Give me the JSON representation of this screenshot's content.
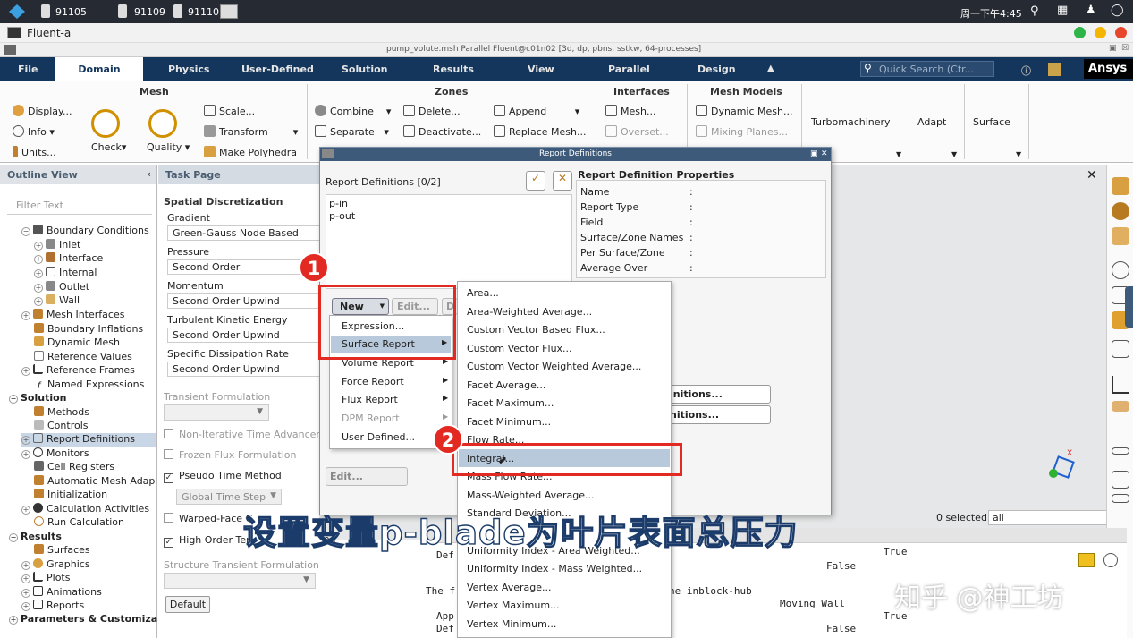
{
  "sysbar": {
    "items": [
      "91105",
      "91109",
      "91110"
    ],
    "clock": "周一下午4:45"
  },
  "window": {
    "title": "Fluent-a",
    "inner_title": "pump_volute.msh Parallel Fluent@c01n02  [3d, dp, pbns, sstkw, 64-processes]"
  },
  "menubar": {
    "tabs": [
      "File",
      "Domain",
      "Physics",
      "User-Defined",
      "Solution",
      "Results",
      "View",
      "Parallel",
      "Design"
    ],
    "search_placeholder": "Quick Search (Ctr...",
    "brand": "Ansys"
  },
  "ribbon": {
    "mesh": {
      "title": "Mesh",
      "display": "Display...",
      "info": "Info",
      "units": "Units...",
      "check": "Check",
      "quality": "Quality",
      "scale": "Scale...",
      "transform": "Transform",
      "make_polyhedra": "Make Polyhedra"
    },
    "zones": {
      "title": "Zones",
      "combine": "Combine",
      "separate": "Separate",
      "delete": "Delete...",
      "deactivate": "Deactivate...",
      "append": "Append",
      "replace_mesh": "Replace Mesh..."
    },
    "interfaces": {
      "title": "Interfaces",
      "mesh": "Mesh...",
      "overset": "Overset..."
    },
    "mesh_models": {
      "title": "Mesh Models",
      "dynamic_mesh": "Dynamic Mesh...",
      "mixing_planes": "Mixing Planes..."
    },
    "turbomachinery": "Turbomachinery",
    "adapt": "Adapt",
    "surface": "Surface"
  },
  "outline": {
    "title": "Outline View",
    "filter_placeholder": "Filter Text",
    "items": [
      "Boundary Conditions",
      "Inlet",
      "Interface",
      "Internal",
      "Outlet",
      "Wall",
      "Mesh Interfaces",
      "Boundary Inflations",
      "Dynamic Mesh",
      "Reference Values",
      "Reference Frames",
      "Named Expressions",
      "Solution",
      "Methods",
      "Controls",
      "Report Definitions",
      "Monitors",
      "Cell Registers",
      "Automatic Mesh Adap",
      "Initialization",
      "Calculation Activities",
      "Run Calculation",
      "Results",
      "Surfaces",
      "Graphics",
      "Plots",
      "Animations",
      "Reports",
      "Parameters & Customiza"
    ]
  },
  "task": {
    "title": "Task Page",
    "section": "Spatial Discretization",
    "gradient_label": "Gradient",
    "gradient_value": "Green-Gauss Node Based",
    "pressure_label": "Pressure",
    "pressure_value": "Second Order",
    "momentum_label": "Momentum",
    "momentum_value": "Second Order Upwind",
    "tke_label": "Turbulent Kinetic Energy",
    "tke_value": "Second Order Upwind",
    "sdr_label": "Specific Dissipation Rate",
    "sdr_value": "Second Order Upwind",
    "transient_label": "Transient Formulation",
    "nita": "Non-Iterative Time Advancen",
    "frozen": "Frozen Flux Formulation",
    "pseudo": "Pseudo Time Method",
    "global_step": "Global Time Step",
    "warped": "Warped-Face G",
    "high_order": "High Order Ter",
    "structure": "Structure Transient Formulation",
    "default_btn": "Default"
  },
  "dialog": {
    "title": "Report Definitions",
    "list_header": "Report Definitions  [0/2]",
    "list_items": [
      "p-in",
      "p-out"
    ],
    "props_title": "Report Definition Properties",
    "props": [
      "Name",
      "Report Type",
      "Field",
      "Surface/Zone Names",
      "Per Surface/Zone",
      "Average Over"
    ],
    "colon": ":",
    "new_btn": "New",
    "edit_btn": "Edit...",
    "d_btn": "D",
    "edit2_btn": "Edit...",
    "side_btn1": "initions...",
    "side_btn2": "nitions..."
  },
  "new_menu": [
    "Expression...",
    "Surface Report",
    "Volume Report",
    "Force Report",
    "Flux Report",
    "DPM Report",
    "User Defined..."
  ],
  "surface_menu": [
    "Area...",
    "Area-Weighted Average...",
    "Custom Vector Based Flux...",
    "Custom Vector Flux...",
    "Custom Vector Weighted Average...",
    "Facet Average...",
    "Facet Maximum...",
    "Facet Minimum...",
    "Flow Rate...",
    "Integral...",
    "Mass Flow Rate...",
    "Mass-Weighted Average...",
    "Standard Deviation...",
    "Uniformity Index - Area Weighted...",
    "Uniformity Index - Mass Weighted...",
    "Vertex Average...",
    "Vertex Maximum...",
    "Vertex Minimum..."
  ],
  "annotations": {
    "step1": "1",
    "step2": "2"
  },
  "graphics": {
    "selected_label": "0 selected",
    "filter_value": "all"
  },
  "console": {
    "lines": [
      "Op",
      "Def",
      "True",
      "False",
      "The f",
      "he inblock-hub",
      "Moving Wall",
      "App",
      "True",
      "Def",
      "False"
    ]
  },
  "subtitle": "设置变量p-blade为叶片表面总压力",
  "watermark": "知乎 @神工坊"
}
